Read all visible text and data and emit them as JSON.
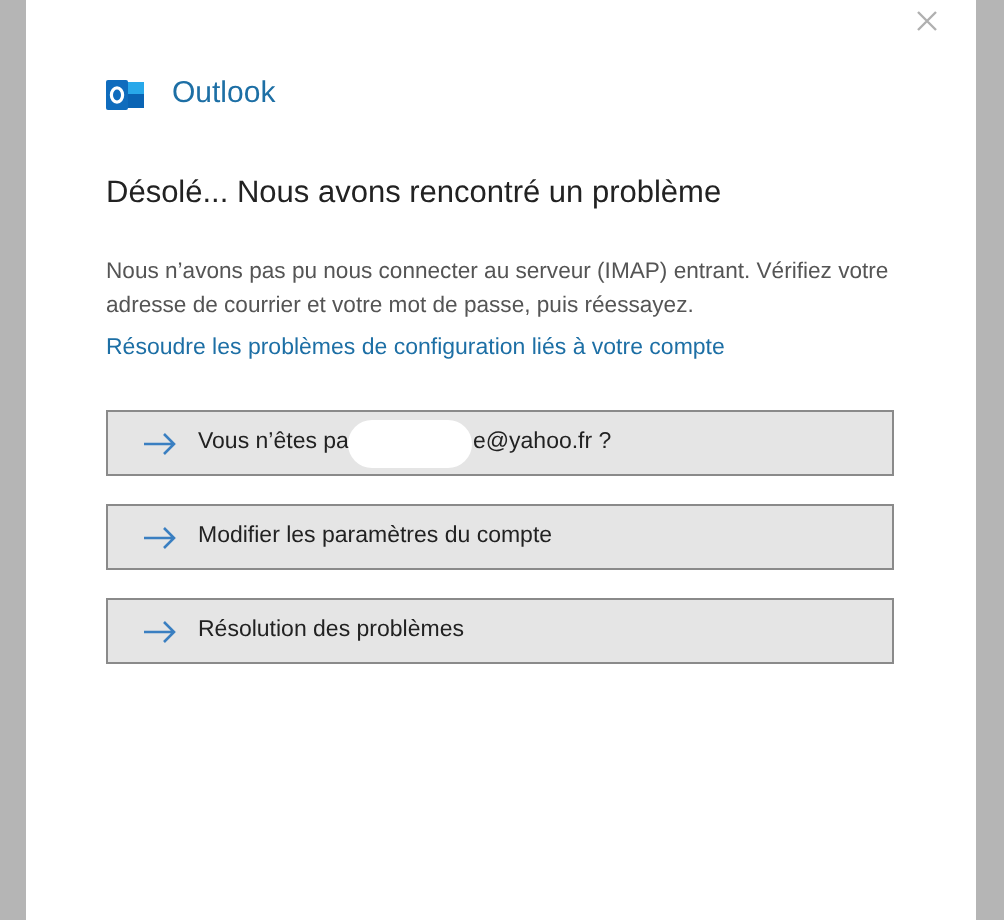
{
  "app": {
    "name": "Outlook"
  },
  "heading": "Désolé... Nous avons rencontré un problème",
  "message": "Nous n’avons pas pu nous connecter au serveur (IMAP) entrant. Vérifiez votre adresse de courrier et votre mot de passe, puis réessayez.",
  "help_link": "Résoudre les problèmes de configuration liés à votre compte",
  "actions": [
    {
      "kind": "account",
      "label": "Vous n’êtes pa",
      "label_end": "e@yahoo.fr ?"
    },
    {
      "kind": "plain",
      "label": "Modifier les paramètres du compte"
    },
    {
      "kind": "plain",
      "label": "Résolution des problèmes"
    }
  ]
}
